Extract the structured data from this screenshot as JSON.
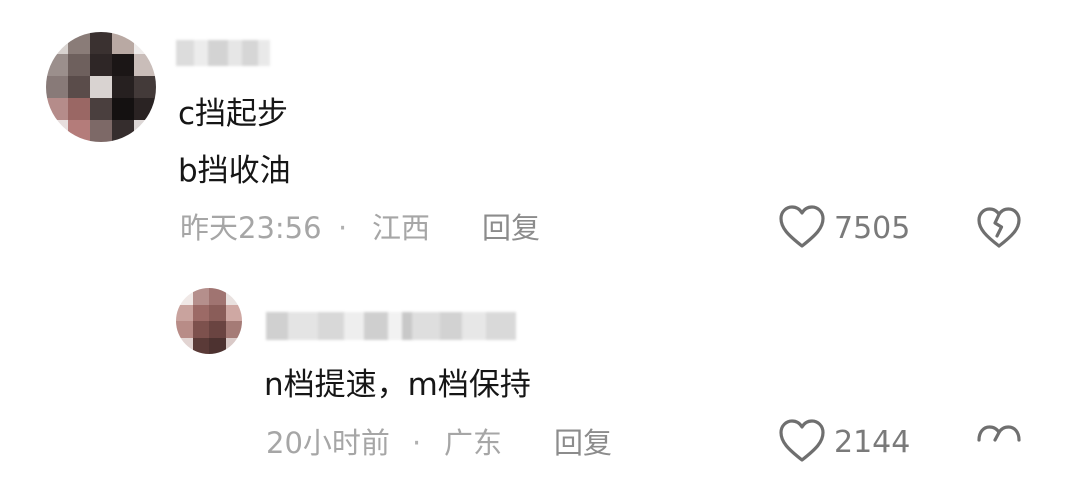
{
  "comment": {
    "lines": [
      "c挡起步",
      "b挡收油"
    ],
    "time": "昨天23:56",
    "separator": "·",
    "location": "江西",
    "reply_label": "回复",
    "likes": "7505",
    "avatar_icon": "pixelated-avatar",
    "like_icon": "heart-outline-icon",
    "dislike_icon": "broken-heart-icon"
  },
  "reply": {
    "text": "n档提速，m档保持",
    "time": "20小时前",
    "separator": "·",
    "location": "广东",
    "reply_label": "回复",
    "likes": "2144",
    "avatar_icon": "pixelated-avatar",
    "like_icon": "heart-outline-icon",
    "dislike_icon": "broken-heart-icon"
  },
  "colors": {
    "text": "#161616",
    "meta": "#a6a6a6",
    "icon": "#6f6f6f",
    "background": "#ffffff"
  }
}
